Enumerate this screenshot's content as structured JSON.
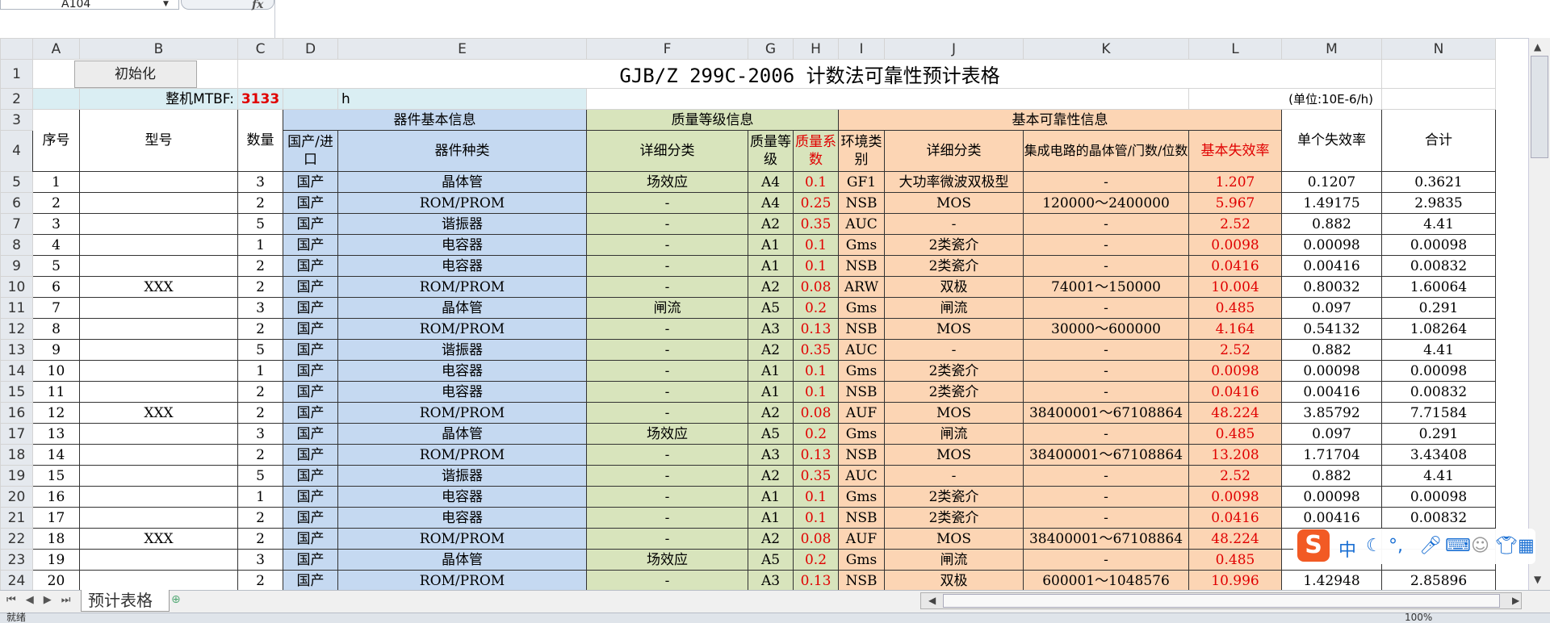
{
  "formula_bar": {
    "name_box": "A104",
    "fx_label": "fx"
  },
  "columns": [
    "A",
    "B",
    "C",
    "D",
    "E",
    "F",
    "G",
    "H",
    "I",
    "J",
    "K",
    "L",
    "M",
    "N"
  ],
  "row1": {
    "init_button": "初始化",
    "title": "GJB/Z 299C-2006 计数法可靠性预计表格"
  },
  "row2": {
    "mtbf_label": "整机MTBF:",
    "mtbf_value": "3133",
    "mtbf_unit": "h",
    "unit_note": "(单位:10E-6/h)"
  },
  "headers": {
    "seq": "序号",
    "model": "型号",
    "qty": "数量",
    "group_basic": "器件基本信息",
    "group_quality": "质量等级信息",
    "group_reliability": "基本可靠性信息",
    "origin": "国产/进口",
    "device_type": "器件种类",
    "detail_class": "详细分类",
    "quality_grade": "质量等级",
    "quality_factor": "质量系数",
    "env_class": "环境类别",
    "detail_class2": "详细分类",
    "ic_count": "集成电路的晶体管/门数/位数",
    "base_failure": "基本失效率",
    "unit_failure": "单个失效率",
    "total": "合计"
  },
  "rows": [
    {
      "r": "5",
      "seq": "1",
      "model": "",
      "qty": "3",
      "origin": "国产",
      "type": "晶体管",
      "detail": "场效应",
      "grade": "A4",
      "factor": "0.1",
      "env": "GF1",
      "detail2": "大功率微波双极型",
      "ic": "-",
      "base": "1.207",
      "unit": "0.1207",
      "total": "0.3621"
    },
    {
      "r": "6",
      "seq": "2",
      "model": "",
      "qty": "2",
      "origin": "国产",
      "type": "ROM/PROM",
      "detail": "-",
      "grade": "A4",
      "factor": "0.25",
      "env": "NSB",
      "detail2": "MOS",
      "ic": "120000～2400000",
      "base": "5.967",
      "unit": "1.49175",
      "total": "2.9835"
    },
    {
      "r": "7",
      "seq": "3",
      "model": "",
      "qty": "5",
      "origin": "国产",
      "type": "谐振器",
      "detail": "-",
      "grade": "A2",
      "factor": "0.35",
      "env": "AUC",
      "detail2": "-",
      "ic": "-",
      "base": "2.52",
      "unit": "0.882",
      "total": "4.41"
    },
    {
      "r": "8",
      "seq": "4",
      "model": "",
      "qty": "1",
      "origin": "国产",
      "type": "电容器",
      "detail": "-",
      "grade": "A1",
      "factor": "0.1",
      "env": "Gms",
      "detail2": "2类瓷介",
      "ic": "-",
      "base": "0.0098",
      "unit": "0.00098",
      "total": "0.00098"
    },
    {
      "r": "9",
      "seq": "5",
      "model": "",
      "qty": "2",
      "origin": "国产",
      "type": "电容器",
      "detail": "-",
      "grade": "A1",
      "factor": "0.1",
      "env": "NSB",
      "detail2": "2类瓷介",
      "ic": "-",
      "base": "0.0416",
      "unit": "0.00416",
      "total": "0.00832"
    },
    {
      "r": "10",
      "seq": "6",
      "model": "XXX",
      "qty": "2",
      "origin": "国产",
      "type": "ROM/PROM",
      "detail": "-",
      "grade": "A2",
      "factor": "0.08",
      "env": "ARW",
      "detail2": "双极",
      "ic": "74001～150000",
      "base": "10.004",
      "unit": "0.80032",
      "total": "1.60064"
    },
    {
      "r": "11",
      "seq": "7",
      "model": "",
      "qty": "3",
      "origin": "国产",
      "type": "晶体管",
      "detail": "闸流",
      "grade": "A5",
      "factor": "0.2",
      "env": "Gms",
      "detail2": "闸流",
      "ic": "-",
      "base": "0.485",
      "unit": "0.097",
      "total": "0.291"
    },
    {
      "r": "12",
      "seq": "8",
      "model": "",
      "qty": "2",
      "origin": "国产",
      "type": "ROM/PROM",
      "detail": "-",
      "grade": "A3",
      "factor": "0.13",
      "env": "NSB",
      "detail2": "MOS",
      "ic": "30000～600000",
      "base": "4.164",
      "unit": "0.54132",
      "total": "1.08264"
    },
    {
      "r": "13",
      "seq": "9",
      "model": "",
      "qty": "5",
      "origin": "国产",
      "type": "谐振器",
      "detail": "-",
      "grade": "A2",
      "factor": "0.35",
      "env": "AUC",
      "detail2": "-",
      "ic": "-",
      "base": "2.52",
      "unit": "0.882",
      "total": "4.41"
    },
    {
      "r": "14",
      "seq": "10",
      "model": "",
      "qty": "1",
      "origin": "国产",
      "type": "电容器",
      "detail": "-",
      "grade": "A1",
      "factor": "0.1",
      "env": "Gms",
      "detail2": "2类瓷介",
      "ic": "-",
      "base": "0.0098",
      "unit": "0.00098",
      "total": "0.00098"
    },
    {
      "r": "15",
      "seq": "11",
      "model": "",
      "qty": "2",
      "origin": "国产",
      "type": "电容器",
      "detail": "-",
      "grade": "A1",
      "factor": "0.1",
      "env": "NSB",
      "detail2": "2类瓷介",
      "ic": "-",
      "base": "0.0416",
      "unit": "0.00416",
      "total": "0.00832"
    },
    {
      "r": "16",
      "seq": "12",
      "model": "XXX",
      "qty": "2",
      "origin": "国产",
      "type": "ROM/PROM",
      "detail": "-",
      "grade": "A2",
      "factor": "0.08",
      "env": "AUF",
      "detail2": "MOS",
      "ic": "38400001～67108864",
      "base": "48.224",
      "unit": "3.85792",
      "total": "7.71584"
    },
    {
      "r": "17",
      "seq": "13",
      "model": "",
      "qty": "3",
      "origin": "国产",
      "type": "晶体管",
      "detail": "场效应",
      "grade": "A5",
      "factor": "0.2",
      "env": "Gms",
      "detail2": "闸流",
      "ic": "-",
      "base": "0.485",
      "unit": "0.097",
      "total": "0.291"
    },
    {
      "r": "18",
      "seq": "14",
      "model": "",
      "qty": "2",
      "origin": "国产",
      "type": "ROM/PROM",
      "detail": "-",
      "grade": "A3",
      "factor": "0.13",
      "env": "NSB",
      "detail2": "MOS",
      "ic": "38400001～67108864",
      "base": "13.208",
      "unit": "1.71704",
      "total": "3.43408"
    },
    {
      "r": "19",
      "seq": "15",
      "model": "",
      "qty": "5",
      "origin": "国产",
      "type": "谐振器",
      "detail": "-",
      "grade": "A2",
      "factor": "0.35",
      "env": "AUC",
      "detail2": "-",
      "ic": "-",
      "base": "2.52",
      "unit": "0.882",
      "total": "4.41"
    },
    {
      "r": "20",
      "seq": "16",
      "model": "",
      "qty": "1",
      "origin": "国产",
      "type": "电容器",
      "detail": "-",
      "grade": "A1",
      "factor": "0.1",
      "env": "Gms",
      "detail2": "2类瓷介",
      "ic": "-",
      "base": "0.0098",
      "unit": "0.00098",
      "total": "0.00098"
    },
    {
      "r": "21",
      "seq": "17",
      "model": "",
      "qty": "2",
      "origin": "国产",
      "type": "电容器",
      "detail": "-",
      "grade": "A1",
      "factor": "0.1",
      "env": "NSB",
      "detail2": "2类瓷介",
      "ic": "-",
      "base": "0.0416",
      "unit": "0.00416",
      "total": "0.00832"
    },
    {
      "r": "22",
      "seq": "18",
      "model": "XXX",
      "qty": "2",
      "origin": "国产",
      "type": "ROM/PROM",
      "detail": "-",
      "grade": "A2",
      "factor": "0.08",
      "env": "AUF",
      "detail2": "MOS",
      "ic": "38400001～67108864",
      "base": "48.224",
      "unit": "",
      "total": ""
    },
    {
      "r": "23",
      "seq": "19",
      "model": "",
      "qty": "3",
      "origin": "国产",
      "type": "晶体管",
      "detail": "场效应",
      "grade": "A5",
      "factor": "0.2",
      "env": "Gms",
      "detail2": "闸流",
      "ic": "-",
      "base": "0.485",
      "unit": "",
      "total": ""
    },
    {
      "r": "24",
      "seq": "20",
      "model": "",
      "qty": "2",
      "origin": "国产",
      "type": "ROM/PROM",
      "detail": "-",
      "grade": "A3",
      "factor": "0.13",
      "env": "NSB",
      "detail2": "双极",
      "ic": "600001～1048576",
      "base": "10.996",
      "unit": "1.42948",
      "total": "2.85896"
    }
  ],
  "sheet_tab": "预计表格",
  "status": {
    "left": "就绪",
    "zoom": "100%"
  },
  "ime": {
    "logo": "S",
    "mode": "中",
    "punct": "°,"
  },
  "colors": {
    "green": "#d8e4bc",
    "blue": "#c5d9f1",
    "orange": "#fcd5b4",
    "cyan": "#daeef3",
    "red": "#e00000"
  }
}
